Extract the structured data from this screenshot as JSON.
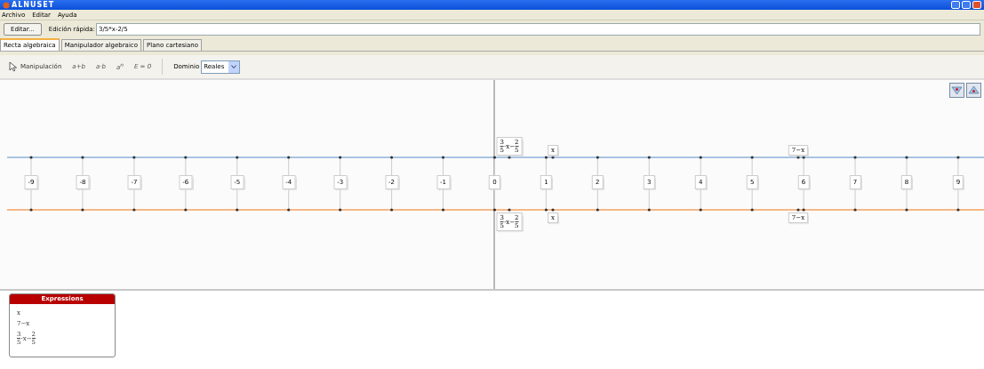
{
  "window": {
    "title": "ALNUSET"
  },
  "menu": [
    "Archivo",
    "Editar",
    "Ayuda"
  ],
  "quick_edit": {
    "button": "Editar...",
    "label": "Edición rápida:",
    "value": "3/5*x-2/5"
  },
  "tabs": [
    {
      "label": "Recta algebraica",
      "selected": true
    },
    {
      "label": "Manipulador algebraico",
      "selected": false
    },
    {
      "label": "Plano cartesiano",
      "selected": false
    }
  ],
  "toolbar": {
    "tools": [
      {
        "kind": "pointer",
        "label": "Manipulación"
      },
      {
        "kind": "op",
        "label": "a+b"
      },
      {
        "kind": "op",
        "label": "a·b"
      },
      {
        "kind": "power",
        "label": "a",
        "sup": "n"
      },
      {
        "kind": "op",
        "label": "E = 0"
      }
    ],
    "domain_label": "Dominio",
    "domain_value": "Reales"
  },
  "number_line": {
    "ticks": [
      "-9",
      "-8",
      "-7",
      "-6",
      "-5",
      "-4",
      "-3",
      "-2",
      "-1",
      "0",
      "1",
      "2",
      "3",
      "4",
      "5",
      "6",
      "7",
      "8",
      "9"
    ],
    "lines": [
      {
        "color": "#a9c4e4",
        "markers": [
          {
            "tokens": [
              {
                "kind": "frac",
                "num": "3",
                "den": "5"
              },
              {
                "kind": "text",
                "text": "·x−"
              },
              {
                "kind": "frac",
                "num": "2",
                "den": "5"
              }
            ]
          },
          {
            "tokens": [
              {
                "kind": "text",
                "text": "x"
              }
            ]
          },
          {
            "tokens": [
              {
                "kind": "text",
                "text": "7−x"
              }
            ]
          }
        ]
      },
      {
        "color": "#f5b887",
        "markers": [
          {
            "tokens": [
              {
                "kind": "frac",
                "num": "3",
                "den": "5"
              },
              {
                "kind": "text",
                "text": "·x−"
              },
              {
                "kind": "frac",
                "num": "2",
                "den": "5"
              }
            ]
          },
          {
            "tokens": [
              {
                "kind": "text",
                "text": "x"
              }
            ]
          },
          {
            "tokens": [
              {
                "kind": "text",
                "text": "7−x"
              }
            ]
          }
        ]
      }
    ]
  },
  "expressions": {
    "title": "Expressions",
    "items": [
      {
        "tokens": [
          {
            "kind": "text",
            "text": "x"
          }
        ]
      },
      {
        "tokens": [
          {
            "kind": "text",
            "text": "7−x"
          }
        ]
      },
      {
        "tokens": [
          {
            "kind": "frac",
            "num": "3",
            "den": "5"
          },
          {
            "kind": "text",
            "text": "·x−"
          },
          {
            "kind": "frac",
            "num": "2",
            "den": "5"
          }
        ]
      }
    ]
  }
}
